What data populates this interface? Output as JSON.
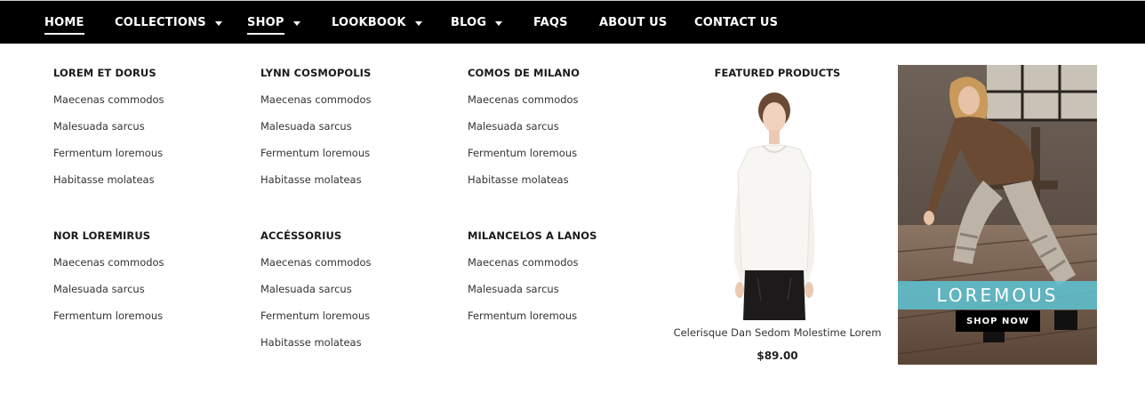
{
  "nav": {
    "items": [
      {
        "label": "HOME",
        "has_caret": false,
        "underlined": true
      },
      {
        "label": "COLLECTIONS",
        "has_caret": true,
        "underlined": false
      },
      {
        "label": "SHOP",
        "has_caret": true,
        "underlined": true
      },
      {
        "label": "LOOKBOOK",
        "has_caret": true,
        "underlined": false
      },
      {
        "label": "BLOG",
        "has_caret": true,
        "underlined": false
      },
      {
        "label": "FAQS",
        "has_caret": false,
        "underlined": false
      },
      {
        "label": "ABOUT US",
        "has_caret": false,
        "underlined": false
      },
      {
        "label": "CONTACT US",
        "has_caret": false,
        "underlined": false
      }
    ]
  },
  "menu": {
    "groups": [
      {
        "title": "LOREM ET DORUS",
        "links": [
          "Maecenas commodos",
          "Malesuada sarcus",
          "Fermentum loremous",
          "Habitasse molateas"
        ]
      },
      {
        "title": "LYNN COSMOPOLIS",
        "links": [
          "Maecenas commodos",
          "Malesuada sarcus",
          "Fermentum loremous",
          "Habitasse molateas"
        ]
      },
      {
        "title": "COMOS DE MILANO",
        "links": [
          "Maecenas commodos",
          "Malesuada sarcus",
          "Fermentum loremous",
          "Habitasse molateas"
        ]
      },
      {
        "title": "NOR LOREMIRUS",
        "links": [
          "Maecenas commodos",
          "Malesuada sarcus",
          "Fermentum loremous"
        ]
      },
      {
        "title": "ACCÉSSORIUS",
        "links": [
          "Maecenas commodos",
          "Malesuada sarcus",
          "Fermentum loremous",
          "Habitasse molateas"
        ]
      },
      {
        "title": "MILANCELOS A LANOS",
        "links": [
          "Maecenas commodos",
          "Malesuada sarcus",
          "Fermentum loremous"
        ]
      }
    ]
  },
  "featured": {
    "title": "FEATURED PRODUCTS",
    "product_name": "Celerisque Dan Sedom Molestime Lorem",
    "price": "$89.00"
  },
  "promo": {
    "headline": "LOREMOUS",
    "button_label": "SHOP NOW",
    "band_color": "#5ec4d3"
  }
}
